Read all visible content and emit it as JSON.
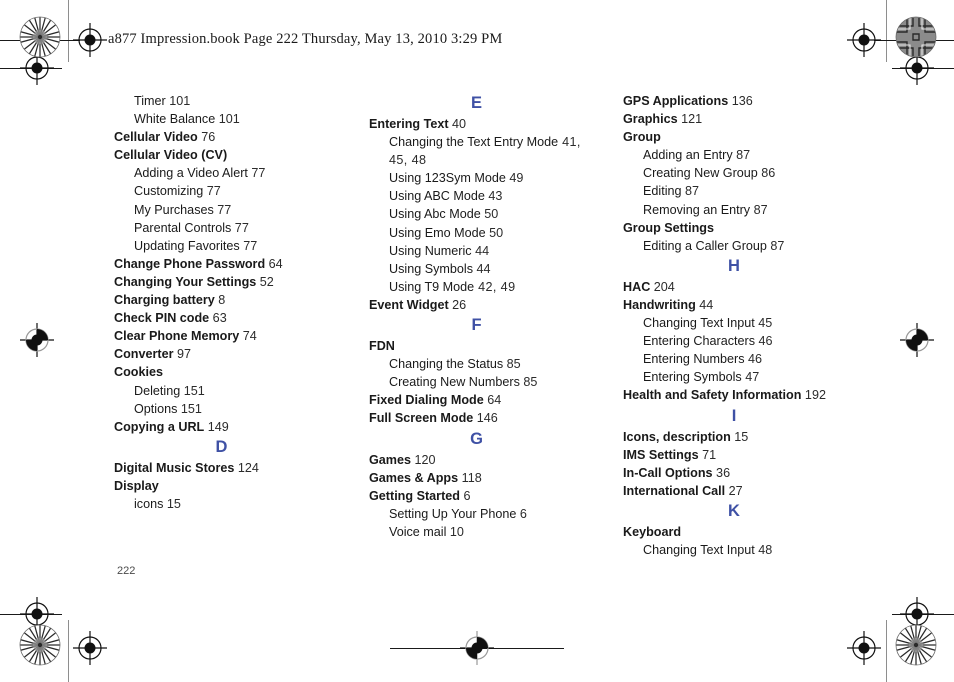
{
  "header": {
    "slug": "a877 Impression.book  Page 222  Thursday, May 13, 2010  3:29 PM"
  },
  "folio": {
    "page_number": "222"
  },
  "colors": {
    "letter_heading": "#3f51a5",
    "body_text": "#1a1a1a",
    "trim_mark": "#8e8e8e"
  },
  "index": {
    "columns": [
      {
        "id": "column-1",
        "blocks": [
          {
            "type": "entries",
            "entries": [
              {
                "level": 1,
                "text": "Timer",
                "pages": "101"
              },
              {
                "level": 1,
                "text": "White Balance",
                "pages": "101"
              },
              {
                "level": 0,
                "text": "Cellular Video",
                "pages": "76"
              },
              {
                "level": 0,
                "text": "Cellular Video (CV)",
                "pages": ""
              },
              {
                "level": 1,
                "text": "Adding a Video Alert",
                "pages": "77"
              },
              {
                "level": 1,
                "text": "Customizing",
                "pages": "77"
              },
              {
                "level": 1,
                "text": "My Purchases",
                "pages": "77"
              },
              {
                "level": 1,
                "text": "Parental Controls",
                "pages": "77"
              },
              {
                "level": 1,
                "text": "Updating Favorites",
                "pages": "77"
              },
              {
                "level": 0,
                "text": "Change Phone Password",
                "pages": "64"
              },
              {
                "level": 0,
                "text": "Changing Your Settings",
                "pages": "52"
              },
              {
                "level": 0,
                "text": "Charging battery",
                "pages": "8"
              },
              {
                "level": 0,
                "text": "Check PIN code",
                "pages": "63"
              },
              {
                "level": 0,
                "text": "Clear Phone Memory",
                "pages": "74"
              },
              {
                "level": 0,
                "text": "Converter",
                "pages": "97"
              },
              {
                "level": 0,
                "text": "Cookies",
                "pages": ""
              },
              {
                "level": 1,
                "text": "Deleting",
                "pages": "151"
              },
              {
                "level": 1,
                "text": "Options",
                "pages": "151"
              },
              {
                "level": 0,
                "text": "Copying a URL",
                "pages": "149"
              }
            ]
          },
          {
            "type": "letter",
            "letter": "D"
          },
          {
            "type": "entries",
            "entries": [
              {
                "level": 0,
                "text": "Digital Music Stores",
                "pages": "124"
              },
              {
                "level": 0,
                "text": "Display",
                "pages": ""
              },
              {
                "level": 1,
                "text": "icons",
                "pages": "15"
              }
            ]
          }
        ]
      },
      {
        "id": "column-2",
        "blocks": [
          {
            "type": "letter",
            "letter": "E"
          },
          {
            "type": "entries",
            "entries": [
              {
                "level": 0,
                "text": "Entering Text",
                "pages": "40"
              },
              {
                "level": 1,
                "text": "Changing the Text Entry Mode",
                "pages": "41, 45, 48",
                "mono": true,
                "wrap": true
              },
              {
                "level": 1,
                "text": "Using 123Sym Mode",
                "pages": "49"
              },
              {
                "level": 1,
                "text": "Using ABC Mode",
                "pages": "43"
              },
              {
                "level": 1,
                "text": "Using Abc Mode",
                "pages": "50"
              },
              {
                "level": 1,
                "text": "Using Emo Mode",
                "pages": "50"
              },
              {
                "level": 1,
                "text": "Using Numeric",
                "pages": "44"
              },
              {
                "level": 1,
                "text": "Using Symbols",
                "pages": "44"
              },
              {
                "level": 1,
                "text": "Using T9 Mode",
                "pages": "42, 49",
                "mono": true
              },
              {
                "level": 0,
                "text": "Event Widget",
                "pages": "26"
              }
            ]
          },
          {
            "type": "letter",
            "letter": "F"
          },
          {
            "type": "entries",
            "entries": [
              {
                "level": 0,
                "text": "FDN",
                "pages": ""
              },
              {
                "level": 1,
                "text": "Changing the Status",
                "pages": "85"
              },
              {
                "level": 1,
                "text": "Creating New Numbers",
                "pages": "85"
              },
              {
                "level": 0,
                "text": "Fixed Dialing Mode",
                "pages": "64"
              },
              {
                "level": 0,
                "text": "Full Screen Mode",
                "pages": "146"
              }
            ]
          },
          {
            "type": "letter",
            "letter": "G"
          },
          {
            "type": "entries",
            "entries": [
              {
                "level": 0,
                "text": "Games",
                "pages": "120"
              },
              {
                "level": 0,
                "text": "Games & Apps",
                "pages": "118"
              },
              {
                "level": 0,
                "text": "Getting Started",
                "pages": "6"
              },
              {
                "level": 1,
                "text": "Setting Up Your Phone",
                "pages": "6"
              },
              {
                "level": 1,
                "text": "Voice mail",
                "pages": "10"
              }
            ]
          }
        ]
      },
      {
        "id": "column-3",
        "blocks": [
          {
            "type": "entries",
            "entries": [
              {
                "level": 0,
                "text": "GPS Applications",
                "pages": "136"
              },
              {
                "level": 0,
                "text": "Graphics",
                "pages": "121"
              },
              {
                "level": 0,
                "text": "Group",
                "pages": ""
              },
              {
                "level": 1,
                "text": "Adding an Entry",
                "pages": "87"
              },
              {
                "level": 1,
                "text": "Creating New Group",
                "pages": "86"
              },
              {
                "level": 1,
                "text": "Editing",
                "pages": "87"
              },
              {
                "level": 1,
                "text": "Removing an Entry",
                "pages": "87"
              },
              {
                "level": 0,
                "text": "Group Settings",
                "pages": ""
              },
              {
                "level": 1,
                "text": "Editing a Caller Group",
                "pages": "87"
              }
            ]
          },
          {
            "type": "letter",
            "letter": "H"
          },
          {
            "type": "entries",
            "entries": [
              {
                "level": 0,
                "text": "HAC",
                "pages": "204"
              },
              {
                "level": 0,
                "text": "Handwriting",
                "pages": "44"
              },
              {
                "level": 1,
                "text": "Changing Text Input",
                "pages": "45"
              },
              {
                "level": 1,
                "text": "Entering Characters",
                "pages": "46"
              },
              {
                "level": 1,
                "text": "Entering Numbers",
                "pages": "46"
              },
              {
                "level": 1,
                "text": "Entering Symbols",
                "pages": "47"
              },
              {
                "level": 0,
                "text": "Health and Safety Information",
                "pages": "192"
              }
            ]
          },
          {
            "type": "letter",
            "letter": "I"
          },
          {
            "type": "entries",
            "entries": [
              {
                "level": 0,
                "text": "Icons, description",
                "pages": "15"
              },
              {
                "level": 0,
                "text": "IMS Settings",
                "pages": "71"
              },
              {
                "level": 0,
                "text": "In-Call Options",
                "pages": "36"
              },
              {
                "level": 0,
                "text": "International Call",
                "pages": "27"
              }
            ]
          },
          {
            "type": "letter",
            "letter": "K"
          },
          {
            "type": "entries",
            "entries": [
              {
                "level": 0,
                "text": "Keyboard",
                "pages": ""
              },
              {
                "level": 1,
                "text": "Changing Text Input",
                "pages": "48"
              }
            ]
          }
        ]
      }
    ]
  }
}
